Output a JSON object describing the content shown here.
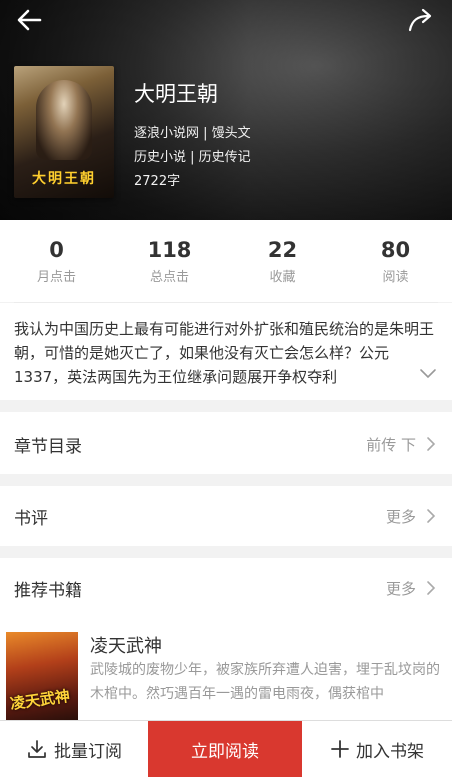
{
  "book": {
    "title": "大明王朝",
    "cover_text": "大明王朝",
    "source": "逐浪小说网 | 馒头文",
    "category": "历史小说 | 历史传记",
    "word_count": "2722字"
  },
  "stats": [
    {
      "value": "0",
      "label": "月点击"
    },
    {
      "value": "118",
      "label": "总点击"
    },
    {
      "value": "22",
      "label": "收藏"
    },
    {
      "value": "80",
      "label": "阅读"
    }
  ],
  "description": "我认为中国历史上最有可能进行对外扩张和殖民统治的是朱明王朝，可惜的是她灭亡了，如果他没有灭亡会怎么样？公元1337，英法两国先为王位继承问题展开争权夺利",
  "sections": {
    "chapters": {
      "label": "章节目录",
      "action": "前传 下"
    },
    "reviews": {
      "label": "书评",
      "action": "更多"
    },
    "recommend": {
      "label": "推荐书籍",
      "action": "更多"
    }
  },
  "recommended": {
    "title": "凌天武神",
    "cover_text": "凌天武神",
    "summary": "武陵城的废物少年，被家族所弃遭人迫害，埋于乱坟岗的木棺中。然巧遇百年一遇的雷电雨夜，偶获棺中"
  },
  "bottom_bar": {
    "subscribe": "批量订阅",
    "read": "立即阅读",
    "add_shelf": "加入书架"
  },
  "colors": {
    "accent": "#d9382f"
  }
}
